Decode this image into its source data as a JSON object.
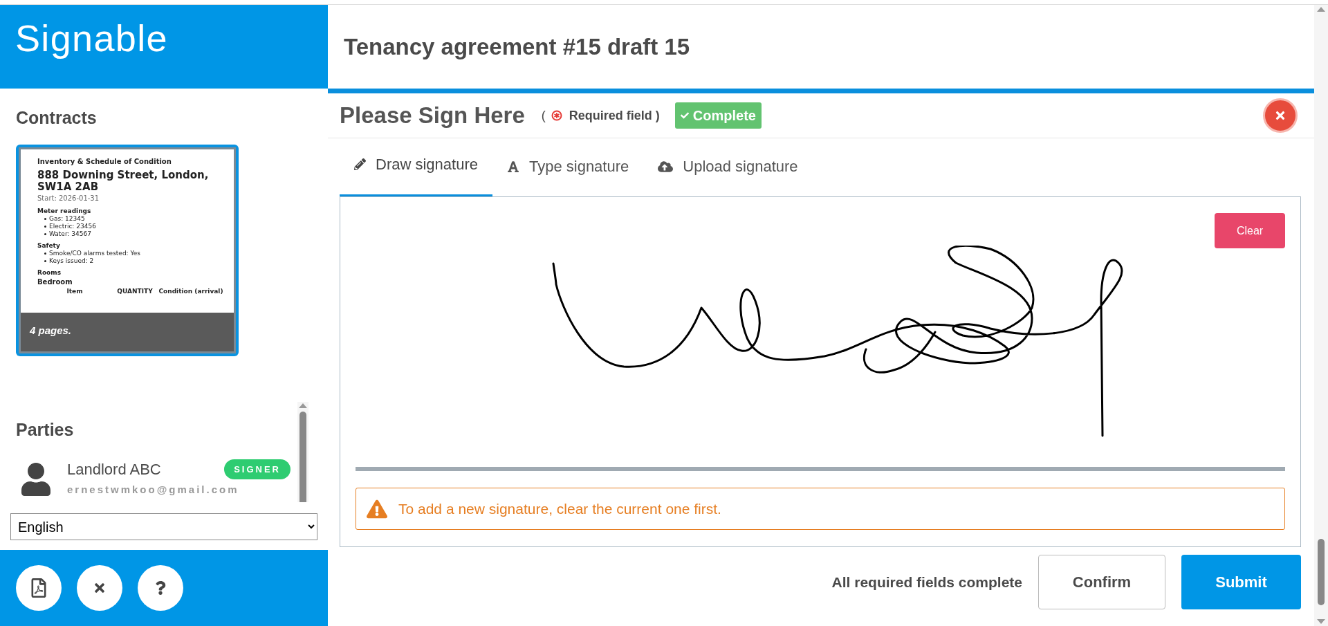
{
  "brand": {
    "logo_text": "Signable"
  },
  "sidebar": {
    "contracts_heading": "Contracts",
    "document": {
      "title": "Inventory & Schedule of Condition",
      "address": "888 Downing Street, London, SW1A 2AB",
      "start": "Start: 2026-01-31",
      "sections": [
        {
          "heading": "Meter readings",
          "items": [
            "Gas: 12345",
            "Electric: 23456",
            "Water: 34567"
          ]
        },
        {
          "heading": "Safety",
          "items": [
            "Smoke/CO alarms tested: Yes",
            "Keys issued: 2"
          ]
        }
      ],
      "rooms_heading": "Rooms",
      "room": "Bedroom",
      "columns": [
        "Item",
        "QUANTITY",
        "Condition (arrival)"
      ],
      "pages": "4 pages.",
      "selected": true
    },
    "parties_heading": "Parties",
    "parties": [
      {
        "name": "Landlord ABC",
        "email": "ernestwmkoo@gmail.com",
        "role": "SIGNER"
      }
    ],
    "language": "English"
  },
  "document_title": "Tenancy agreement #15 draft 15",
  "field": {
    "heading": "Please Sign Here",
    "required_prefix": "(",
    "required_label": "Required field )",
    "status": "Complete",
    "complete": true
  },
  "tabs": [
    {
      "kind": "draw",
      "label": "Draw signature",
      "selected": true
    },
    {
      "kind": "type",
      "label": "Type signature",
      "selected": false
    },
    {
      "kind": "upload",
      "label": "Upload signature",
      "selected": false
    }
  ],
  "canvas": {
    "clear": "Clear",
    "has_signature": true
  },
  "warning": "To add a new signature, clear the current one first.",
  "footer": {
    "status": "All required fields complete",
    "confirm": "Confirm",
    "submit": "Submit"
  }
}
